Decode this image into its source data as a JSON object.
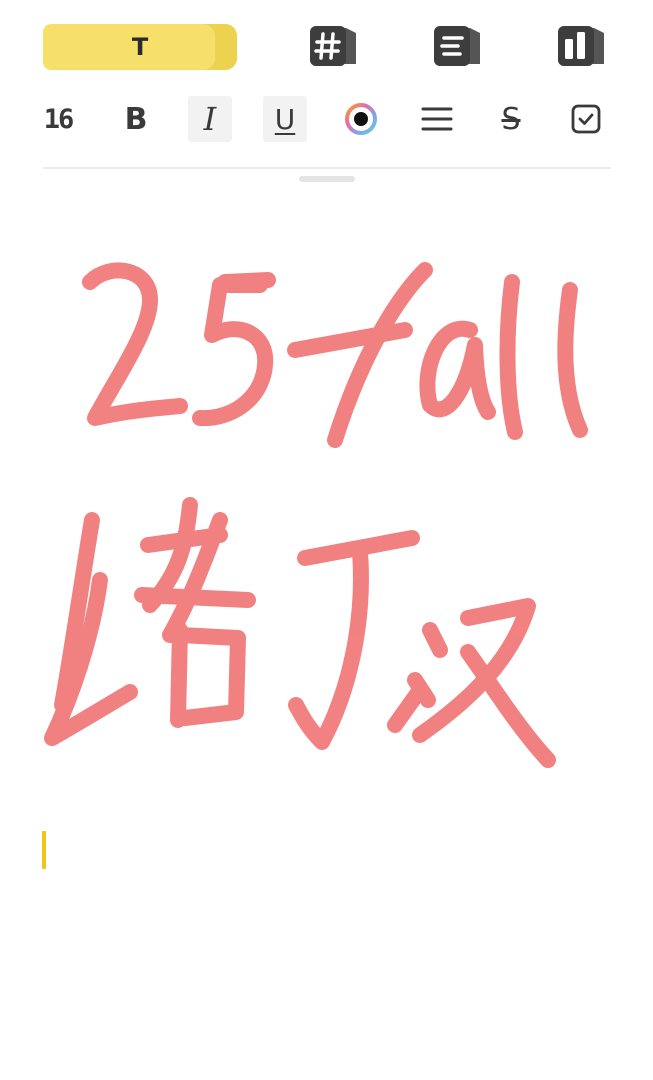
{
  "toolbar": {
    "text_tool": "T",
    "tools": [
      {
        "name": "hashtag-block",
        "icon": "hash-icon"
      },
      {
        "name": "list-block",
        "icon": "list-icon"
      },
      {
        "name": "columns-block",
        "icon": "columns-icon"
      }
    ],
    "accent": "#f7e06a"
  },
  "format_bar": {
    "font_size": "16",
    "bold": "B",
    "italic": "I",
    "underline": "U",
    "strike": "S",
    "icons": [
      "color-picker-icon",
      "align-icon",
      "checkbox-icon"
    ]
  },
  "note": {
    "ink_color": "#f07070",
    "caret_color": "#f0c419"
  }
}
